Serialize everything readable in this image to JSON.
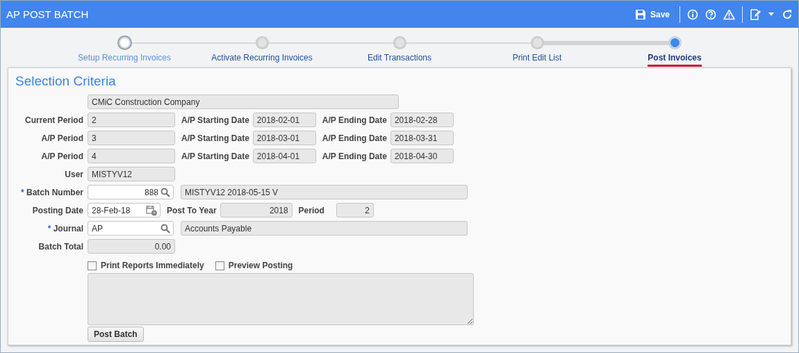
{
  "window": {
    "title": "AP POST BATCH"
  },
  "toolbar": {
    "save_label": "Save"
  },
  "steps": [
    {
      "label": "Setup Recurring Invoices",
      "visited": true,
      "selected": false
    },
    {
      "label": "Activate Recurring Invoices",
      "visited": false,
      "selected": false
    },
    {
      "label": "Edit Transactions",
      "visited": false,
      "selected": false
    },
    {
      "label": "Print Edit List",
      "visited": false,
      "selected": false
    },
    {
      "label": "Post Invoices",
      "visited": false,
      "selected": true
    }
  ],
  "section": {
    "title": "Selection Criteria",
    "required_mark": "*"
  },
  "rows": [
    {
      "items": [
        {
          "kind": "wide",
          "value": "CMiC Construction Company"
        }
      ]
    },
    {
      "label": "Current Period",
      "required": false,
      "items": [
        {
          "kind": "short",
          "value": "2"
        },
        {
          "kind": "label",
          "text": "A/P Starting Date"
        },
        {
          "kind": "date",
          "value": "2018-02-01"
        },
        {
          "kind": "label",
          "text": "A/P Ending Date"
        },
        {
          "kind": "date",
          "value": "2018-02-28"
        }
      ]
    },
    {
      "label": "A/P Period",
      "required": false,
      "items": [
        {
          "kind": "short",
          "value": "3"
        },
        {
          "kind": "label",
          "text": "A/P Starting Date"
        },
        {
          "kind": "date",
          "value": "2018-03-01"
        },
        {
          "kind": "label",
          "text": "A/P Ending Date"
        },
        {
          "kind": "date",
          "value": "2018-03-31"
        }
      ]
    },
    {
      "label": "A/P Period",
      "required": false,
      "items": [
        {
          "kind": "short",
          "value": "4"
        },
        {
          "kind": "label",
          "text": "A/P Starting Date"
        },
        {
          "kind": "date",
          "value": "2018-04-01"
        },
        {
          "kind": "label",
          "text": "A/P Ending Date"
        },
        {
          "kind": "date",
          "value": "2018-04-30"
        }
      ]
    },
    {
      "label": "User",
      "required": false,
      "items": [
        {
          "kind": "short",
          "value": "MISTYV12"
        }
      ]
    },
    {
      "label": "Batch Number",
      "required": true,
      "items": [
        {
          "kind": "lookup",
          "value": "888",
          "numeric": true
        },
        {
          "kind": "desc",
          "value": "MISTYV12 2018-05-15 V"
        }
      ]
    },
    {
      "label": "Posting Date",
      "required": false,
      "items": [
        {
          "kind": "datepicker",
          "value": "28-Feb-18"
        },
        {
          "kind": "label",
          "text": "Post To Year"
        },
        {
          "kind": "year",
          "value": "2018",
          "numeric": true
        },
        {
          "kind": "label",
          "text": "Period"
        },
        {
          "kind": "period",
          "value": "2",
          "numeric": true
        }
      ]
    },
    {
      "label": "Journal",
      "required": true,
      "items": [
        {
          "kind": "lookup",
          "value": "AP",
          "numeric": false
        },
        {
          "kind": "desc",
          "value": "Accounts Payable"
        }
      ]
    },
    {
      "label": "Batch Total",
      "required": false,
      "items": [
        {
          "kind": "short",
          "value": "0.00",
          "numeric": true
        }
      ]
    }
  ],
  "checkboxes": [
    {
      "label": "Print Reports Immediately",
      "checked": false
    },
    {
      "label": "Preview Posting",
      "checked": false
    }
  ],
  "buttons": [
    {
      "label": "Post Batch"
    }
  ]
}
